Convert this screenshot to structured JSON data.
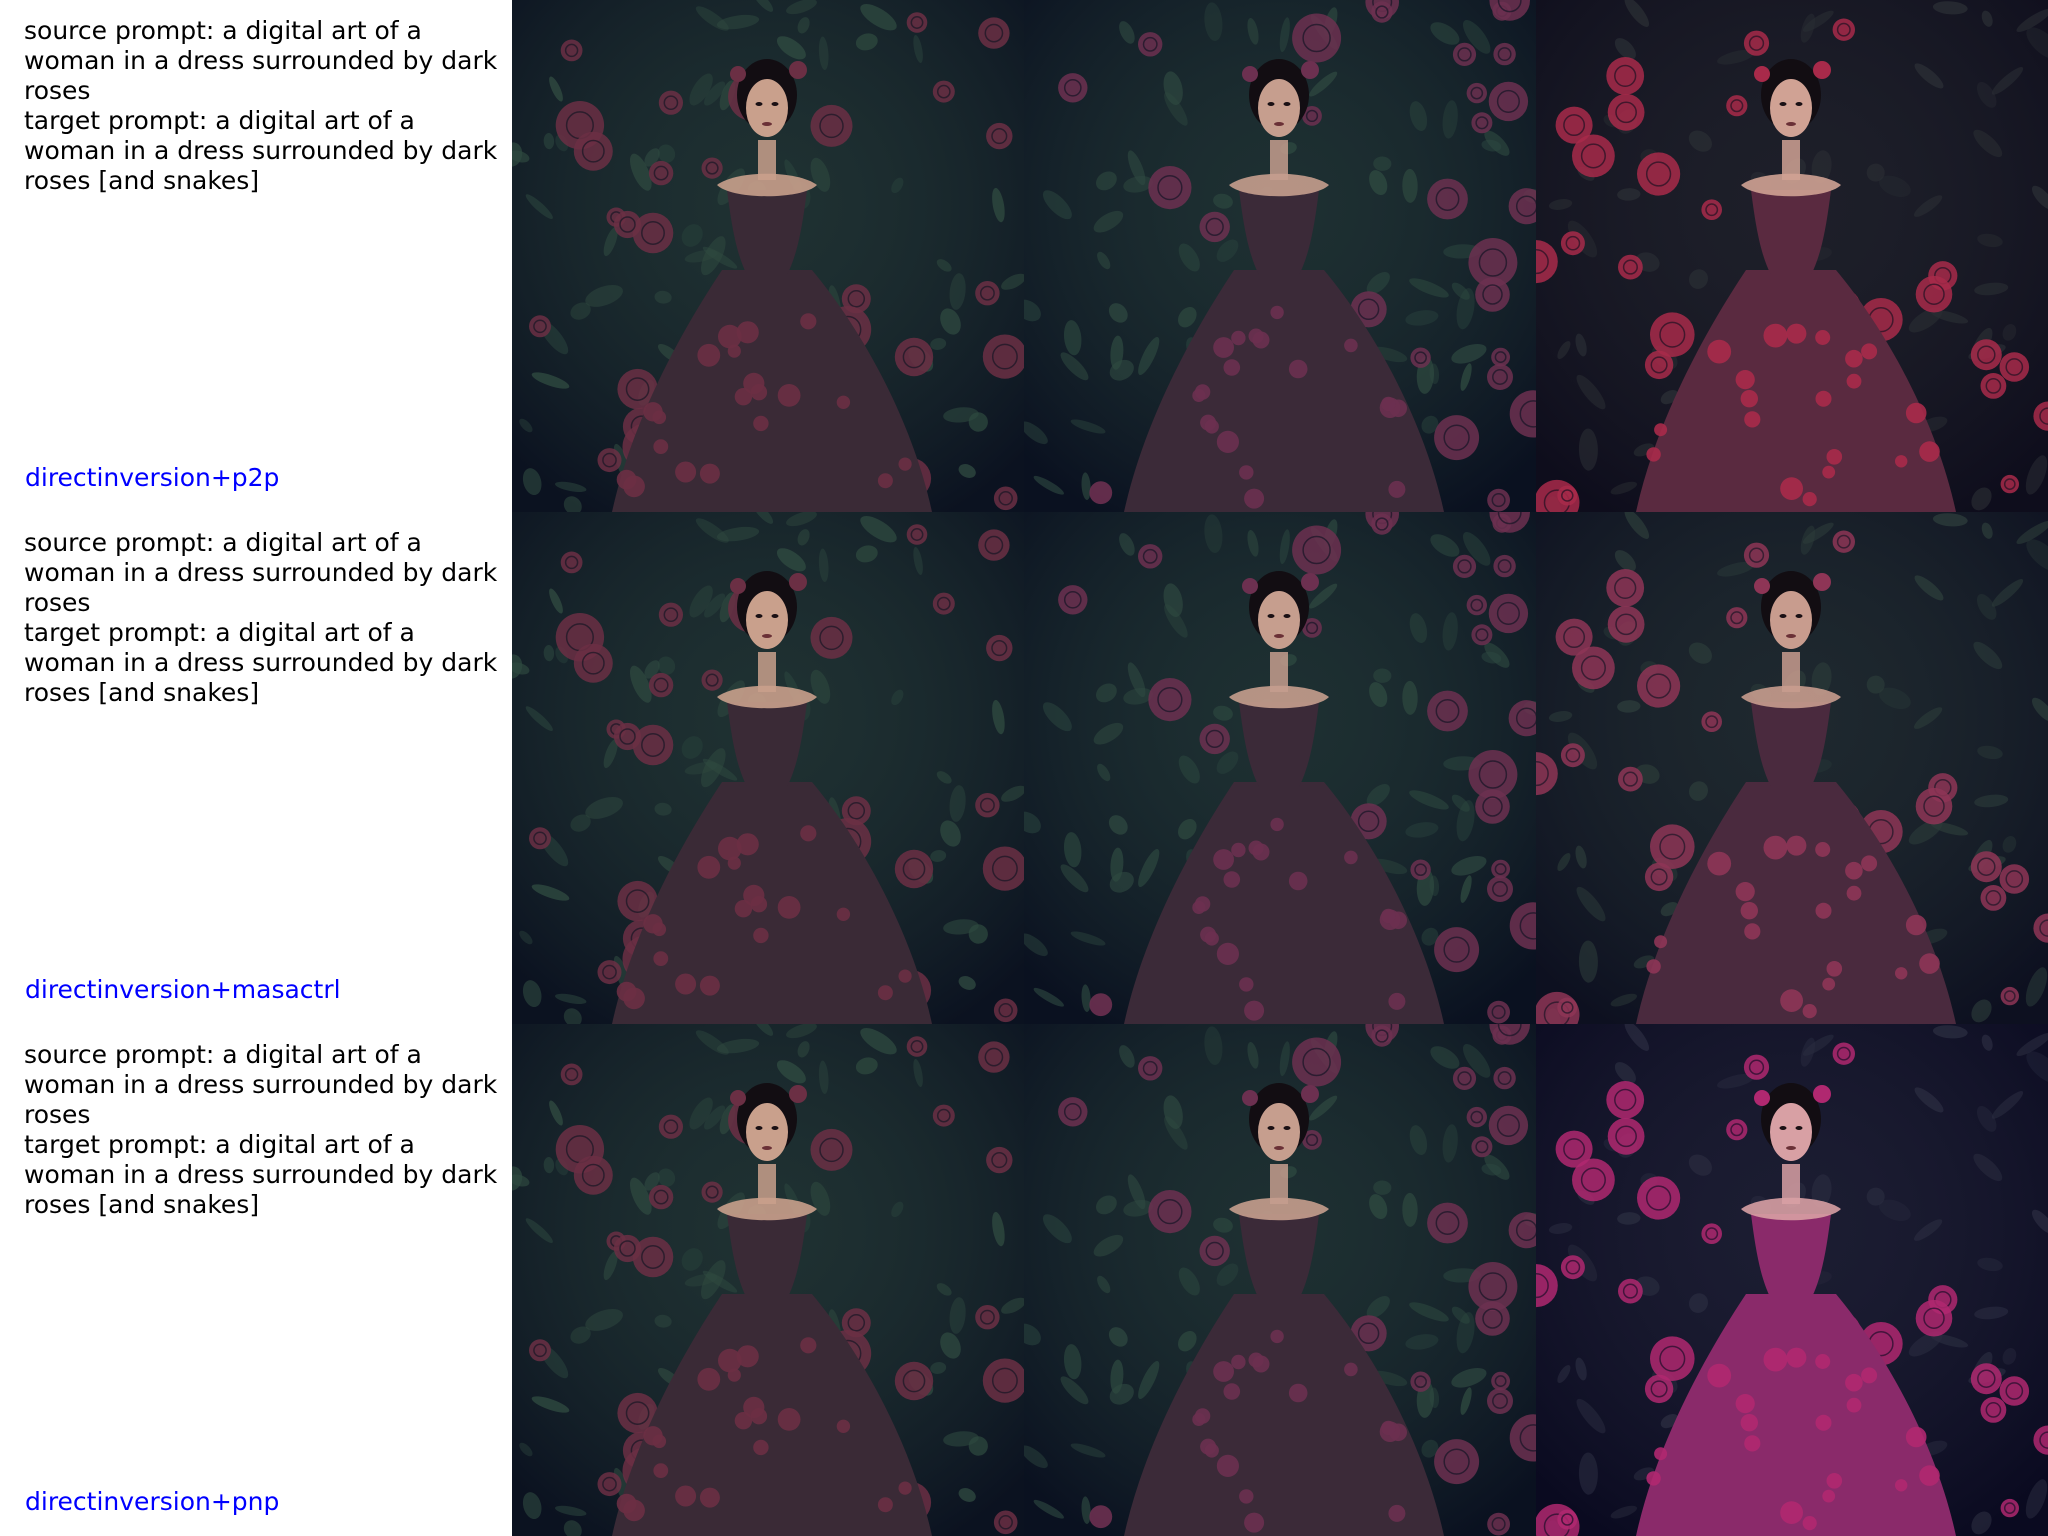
{
  "rows": [
    {
      "prompt_text": "source prompt: a digital art of a\nwoman in a dress surrounded by dark\nroses\ntarget prompt: a digital art of a\nwoman in a dress surrounded by dark\nroses [and snakes]",
      "method": "directinversion+p2p"
    },
    {
      "prompt_text": "source prompt: a digital art of a\nwoman in a dress surrounded by dark\nroses\ntarget prompt: a digital art of a\nwoman in a dress surrounded by dark\nroses [and snakes]",
      "method": "directinversion+masactrl"
    },
    {
      "prompt_text": "source prompt: a digital art of a\nwoman in a dress surrounded by dark\nroses\ntarget prompt: a digital art of a\nwoman in a dress surrounded by dark\nroses [and snakes]",
      "method": "directinversion+pnp"
    }
  ],
  "image_palettes": [
    [
      "#0b1220",
      "#2f4a40",
      "#6b2f44",
      "#c9a08c",
      "#3a2a36"
    ],
    [
      "#0a1120",
      "#2e4940",
      "#6c3050",
      "#c69e8e",
      "#3b2a38"
    ],
    [
      "#0e0d1c",
      "#2a2e34",
      "#a82a4a",
      "#d0a294",
      "#5a2a40"
    ],
    [
      "#0b1220",
      "#2f4a40",
      "#6b2f44",
      "#c9a08c",
      "#3a2a36"
    ],
    [
      "#0a1120",
      "#2e4940",
      "#6c3050",
      "#c69e8e",
      "#3b2a38"
    ],
    [
      "#0d1020",
      "#2c3c3a",
      "#8e3556",
      "#c89c8e",
      "#4a2a3e"
    ],
    [
      "#0b1220",
      "#2f4a40",
      "#6b2f44",
      "#c9a08c",
      "#3a2a36"
    ],
    [
      "#0a1120",
      "#2e4940",
      "#6c3050",
      "#c69e8e",
      "#3b2a38"
    ],
    [
      "#0a0a20",
      "#2a2c40",
      "#b02870",
      "#d8a0a4",
      "#8a2a6a"
    ]
  ]
}
